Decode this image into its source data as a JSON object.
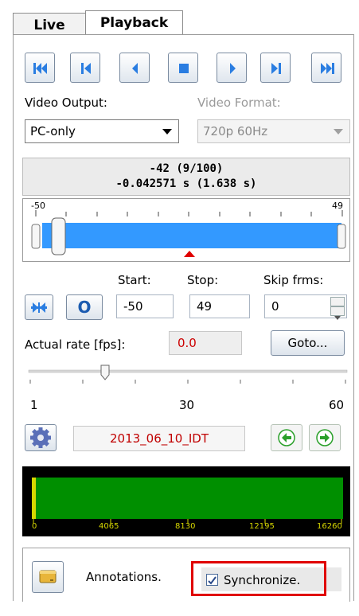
{
  "tabs": [
    {
      "label": "Live"
    },
    {
      "label": "Playback"
    }
  ],
  "transport": {
    "buttons": [
      "skip-to-start-icon",
      "previous-frame-icon",
      "play-reverse-icon",
      "stop-icon",
      "play-icon",
      "next-frame-icon",
      "skip-to-end-icon"
    ]
  },
  "video_output": {
    "label": "Video Output:",
    "value": "PC-only"
  },
  "video_format": {
    "label": "Video Format:",
    "value": "720p 60Hz"
  },
  "frame_info": {
    "line1": "-42 (9/100)",
    "line2": "-0.042571 s (1.638 s)"
  },
  "range_slider": {
    "min_label": "-50",
    "max_label": "49",
    "position_fraction": 0.49
  },
  "start": {
    "label": "Start:",
    "value": "-50"
  },
  "stop": {
    "label": "Stop:",
    "value": "49"
  },
  "skip": {
    "label": "Skip frms:",
    "value": "0"
  },
  "o_button": {
    "label": "O"
  },
  "actual_rate": {
    "label": "Actual rate [fps]:",
    "value": "0.0"
  },
  "goto": {
    "label": "Goto..."
  },
  "rate_slider": {
    "min": "1",
    "mid": "30",
    "max": "60",
    "value": 15
  },
  "recording_name": "2013_06_10_IDT",
  "timeline": {
    "ticks": [
      "0",
      "4065",
      "8130",
      "12195",
      "16260"
    ]
  },
  "annotations": {
    "label": "Annotations."
  },
  "synchronize": {
    "label": "Synchronize.",
    "checked": true
  },
  "colors": {
    "accent_blue": "#3399ff",
    "timeline_green": "#008f00",
    "marker_red": "#e00000",
    "highlight_red": "#e00000"
  }
}
